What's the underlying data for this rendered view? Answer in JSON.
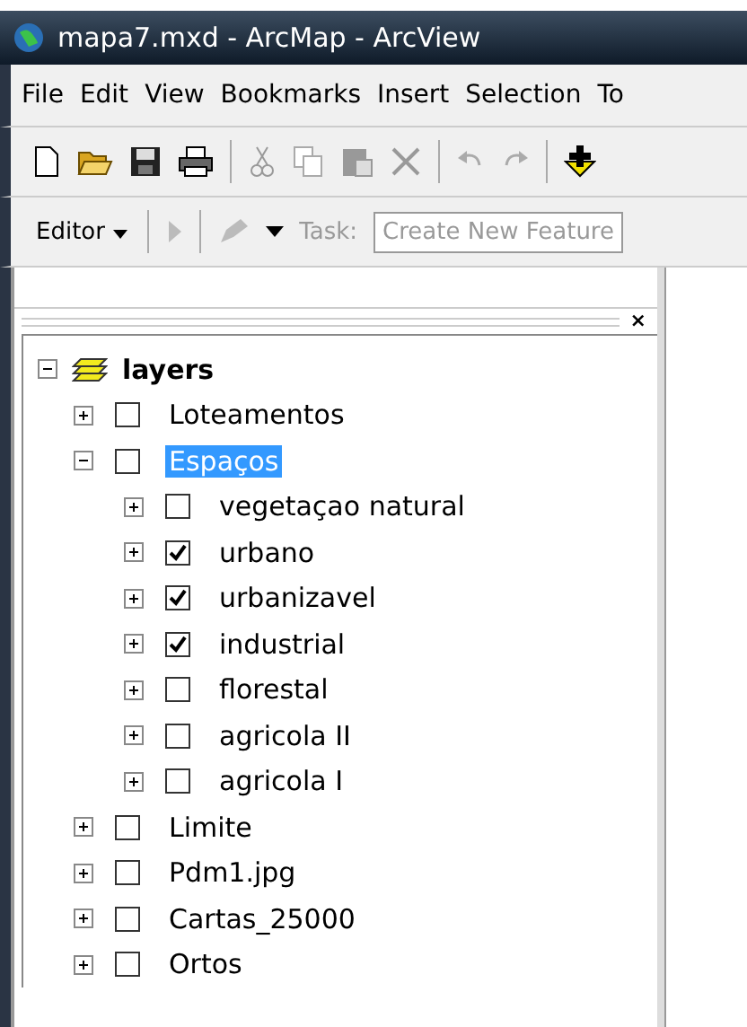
{
  "window": {
    "title": "mapa7.mxd - ArcMap - ArcView"
  },
  "menu": [
    "File",
    "Edit",
    "View",
    "Bookmarks",
    "Insert",
    "Selection",
    "To"
  ],
  "editor_toolbar": {
    "editor_button": "Editor",
    "task_label": "Task:",
    "task_value": "Create New Feature"
  },
  "toc": {
    "close": "×",
    "root": {
      "label": "layers",
      "expanded": true,
      "children": [
        {
          "label": "Loteamentos",
          "expanded": false,
          "checked": false,
          "selected": false
        },
        {
          "label": "Espaços",
          "expanded": true,
          "checked": false,
          "selected": true,
          "children": [
            {
              "label": "vegetaçao natural",
              "expanded": false,
              "checked": false,
              "selected": false
            },
            {
              "label": "urbano",
              "expanded": false,
              "checked": true,
              "selected": false
            },
            {
              "label": "urbanizavel",
              "expanded": false,
              "checked": true,
              "selected": false
            },
            {
              "label": "industrial",
              "expanded": false,
              "checked": true,
              "selected": false
            },
            {
              "label": "florestal",
              "expanded": false,
              "checked": false,
              "selected": false
            },
            {
              "label": "agricola II",
              "expanded": false,
              "checked": false,
              "selected": false
            },
            {
              "label": "agricola I",
              "expanded": false,
              "checked": false,
              "selected": false
            }
          ]
        },
        {
          "label": "Limite",
          "expanded": false,
          "checked": false,
          "selected": false
        },
        {
          "label": "Pdm1.jpg",
          "expanded": false,
          "checked": false,
          "selected": false
        },
        {
          "label": "Cartas_25000",
          "expanded": false,
          "checked": false,
          "selected": false
        },
        {
          "label": "Ortos",
          "expanded": false,
          "checked": false,
          "selected": false
        }
      ]
    }
  }
}
